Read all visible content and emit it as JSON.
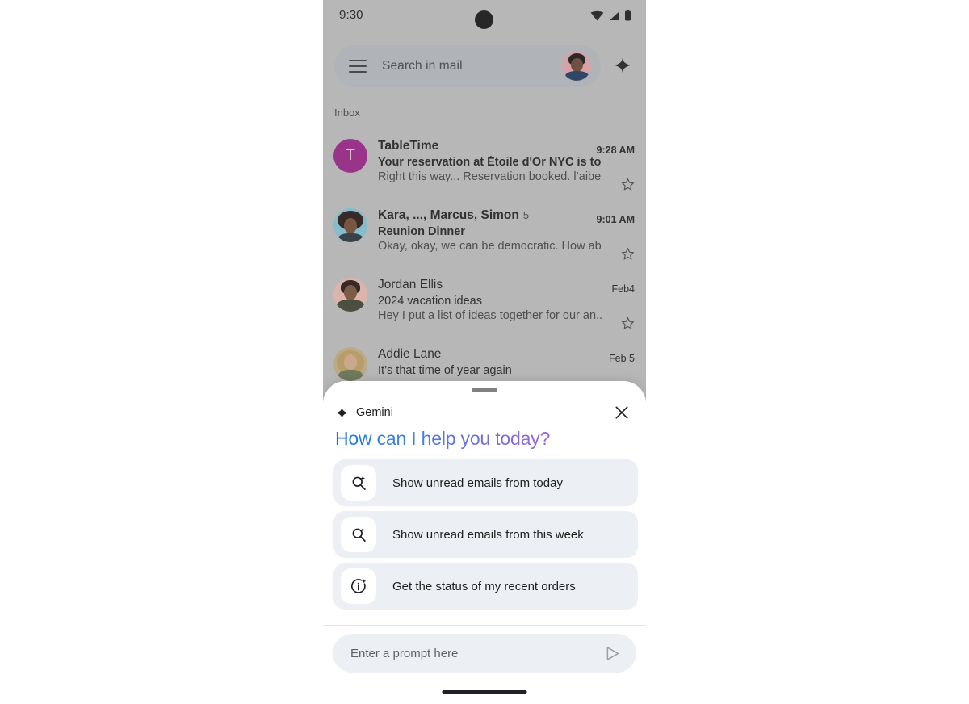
{
  "statusbar": {
    "time": "9:30",
    "icons": [
      "wifi-icon",
      "cellular-signal-icon",
      "battery-icon"
    ]
  },
  "search": {
    "placeholder": "Search in mail",
    "menu_icon": "hamburger-menu-icon",
    "avatar": "account-avatar",
    "gemini_icon": "gemini-sparkle-icon"
  },
  "inbox": {
    "label": "Inbox",
    "rows": [
      {
        "avatar_type": "letter",
        "avatar_letter": "T",
        "avatar_color": "#a4228f",
        "sender": "TableTime",
        "count": "",
        "subject": "Your reservation at Étoile d'Or NYC is to...",
        "snippet": "Right this way... Reservation booked. l’aibell...",
        "date": "9:28 AM",
        "unread": true,
        "star": "star-outline-icon"
      },
      {
        "avatar_type": "photo",
        "avatar_color": "#86cde0",
        "sender": "Kara, ..., Marcus, Simon",
        "count": "5",
        "subject": "Reunion Dinner",
        "snippet": "Okay, okay, we can be democratic. How abo...",
        "date": "9:01 AM",
        "unread": true,
        "star": "star-outline-icon"
      },
      {
        "avatar_type": "photo",
        "avatar_color": "#f6c3bb",
        "sender": "Jordan Ellis",
        "count": "",
        "subject": "2024 vacation ideas",
        "snippet": "Hey I put a list of ideas together for our an...",
        "date": "Feb4",
        "unread": false,
        "star": "star-outline-icon"
      },
      {
        "avatar_type": "photo",
        "avatar_color": "#d8c49a",
        "sender": "Addie Lane",
        "count": "",
        "subject": "It’s that time of year again",
        "snippet": "",
        "date": "Feb 5",
        "unread": false,
        "star": ""
      }
    ]
  },
  "gemini_sheet": {
    "handle": "drag-handle",
    "brand_icon": "gemini-sparkle-icon",
    "brand_label": "Gemini",
    "close_icon": "close-icon",
    "heading": "How can I help you today?",
    "heading_gradient_start": "#1b76e8",
    "heading_gradient_end": "#9a68d8",
    "suggestions": [
      {
        "icon": "search-sparkle-icon",
        "label": "Show unread emails from today"
      },
      {
        "icon": "search-sparkle-icon",
        "label": "Show unread emails from this week"
      },
      {
        "icon": "info-sparkle-icon",
        "label": "Get the status of my recent orders"
      }
    ],
    "composer": {
      "placeholder": "Enter a prompt here",
      "value": "",
      "send_icon": "send-icon"
    }
  },
  "navigation": {
    "gesture_bar": "gesture-navigation-bar"
  }
}
